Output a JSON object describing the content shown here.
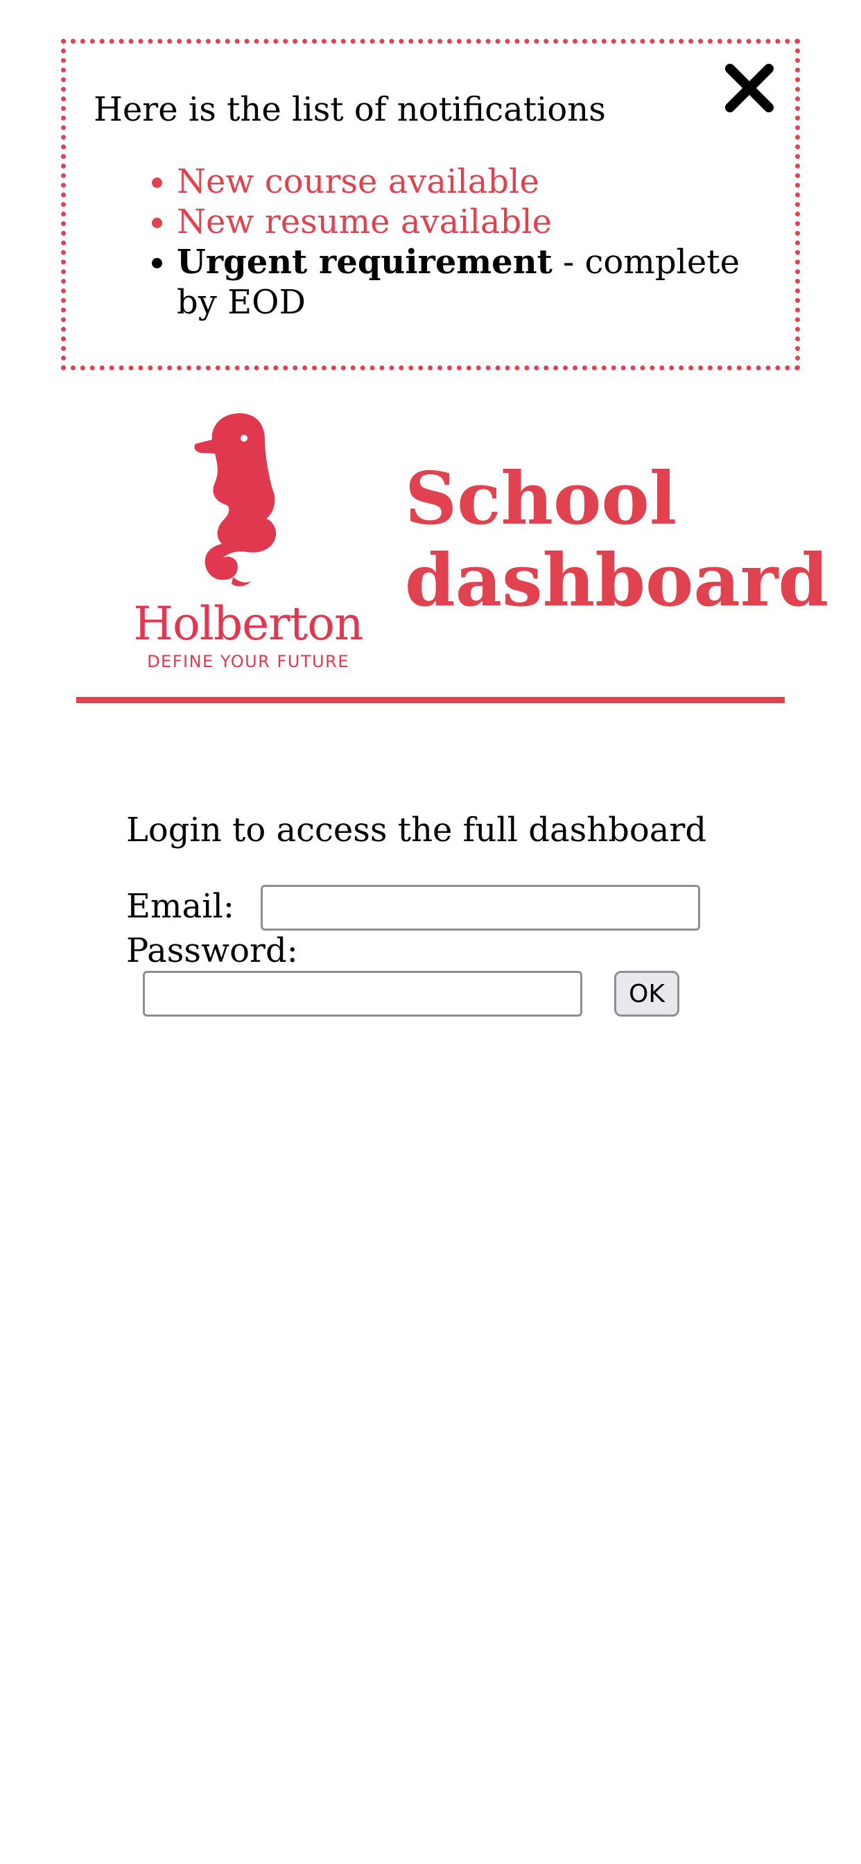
{
  "colors": {
    "accent": "#e0434f",
    "text": "#000000",
    "input_border": "#8e8e93",
    "button_bg": "#e8e8ed"
  },
  "notifications": {
    "title": "Here is the list of notifications",
    "close_icon": "close-icon",
    "items": [
      {
        "type": "default",
        "text": "New course available"
      },
      {
        "type": "default",
        "text": "New resume available"
      },
      {
        "type": "urgent",
        "strong": "Urgent requirement",
        "rest": " - complete by EOD"
      }
    ]
  },
  "header": {
    "logo": {
      "icon": "seahorse-logo-icon",
      "wordmark": "Holberton",
      "tagline": "DEFINE YOUR FUTURE"
    },
    "title": "School dashboard"
  },
  "login": {
    "intro": "Login to access the full dashboard",
    "email_label": "Email:",
    "email_value": "",
    "password_label": "Password:",
    "password_value": "",
    "submit_label": "OK"
  }
}
